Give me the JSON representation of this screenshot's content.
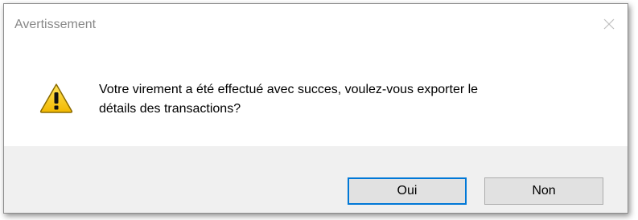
{
  "dialog": {
    "title": "Avertissement",
    "close_icon": "close-icon",
    "message_line1": "Votre virement a été effectué avec succes, voulez-vous exporter le",
    "message_line2": "détails des transactions?",
    "icon": "warning-icon",
    "buttons": {
      "yes_label": "Oui",
      "no_label": "Non"
    }
  },
  "colors": {
    "warning_fill": "#f5c400",
    "footer_bg": "#f0f0f0",
    "default_button_border": "#0078d7"
  }
}
